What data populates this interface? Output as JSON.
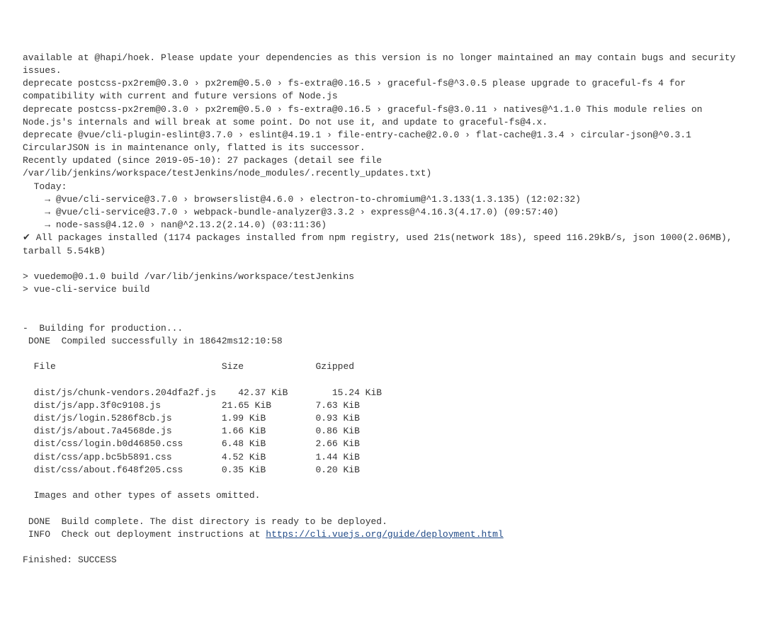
{
  "lines": [
    "available at @hapi/hoek. Please update your dependencies as this version is no longer maintained an may contain bugs and security issues.",
    "deprecate postcss-px2rem@0.3.0 › px2rem@0.5.0 › fs-extra@0.16.5 › graceful-fs@^3.0.5 please upgrade to graceful-fs 4 for compatibility with current and future versions of Node.js",
    "deprecate postcss-px2rem@0.3.0 › px2rem@0.5.0 › fs-extra@0.16.5 › graceful-fs@3.0.11 › natives@^1.1.0 This module relies on Node.js's internals and will break at some point. Do not use it, and update to graceful-fs@4.x.",
    "deprecate @vue/cli-plugin-eslint@3.7.0 › eslint@4.19.1 › file-entry-cache@2.0.0 › flat-cache@1.3.4 › circular-json@^0.3.1 CircularJSON is in maintenance only, flatted is its successor.",
    "Recently updated (since 2019-05-10): 27 packages (detail see file /var/lib/jenkins/workspace/testJenkins/node_modules/.recently_updates.txt)",
    "  Today:",
    "    → @vue/cli-service@3.7.0 › browserslist@4.6.0 › electron-to-chromium@^1.3.133(1.3.135) (12:02:32)",
    "    → @vue/cli-service@3.7.0 › webpack-bundle-analyzer@3.3.2 › express@^4.16.3(4.17.0) (09:57:40)",
    "    → node-sass@4.12.0 › nan@^2.13.2(2.14.0) (03:11:36)",
    "✔ All packages installed (1174 packages installed from npm registry, used 21s(network 18s), speed 116.29kB/s, json 1000(2.06MB), tarball 5.54kB)",
    "",
    "> vuedemo@0.1.0 build /var/lib/jenkins/workspace/testJenkins",
    "> vue-cli-service build",
    "",
    "",
    "-  Building for production...",
    " DONE  Compiled successfully in 18642ms12:10:58",
    "",
    "  File                              Size             Gzipped",
    "",
    "  dist/js/chunk-vendors.204dfa2f.js    42.37 KiB        15.24 KiB",
    "  dist/js/app.3f0c9108.js           21.65 KiB        7.63 KiB",
    "  dist/js/login.5286f8cb.js         1.99 KiB         0.93 KiB",
    "  dist/js/about.7a4568de.js         1.66 KiB         0.86 KiB",
    "  dist/css/login.b0d46850.css       6.48 KiB         2.66 KiB",
    "  dist/css/app.bc5b5891.css         4.52 KiB         1.44 KiB",
    "  dist/css/about.f648f205.css       0.35 KiB         0.20 KiB",
    "",
    "  Images and other types of assets omitted.",
    "",
    " DONE  Build complete. The dist directory is ready to be deployed."
  ],
  "info_prefix": " INFO  Check out deployment instructions at ",
  "info_link": "https://cli.vuejs.org/guide/deployment.html",
  "footer": "Finished: SUCCESS"
}
